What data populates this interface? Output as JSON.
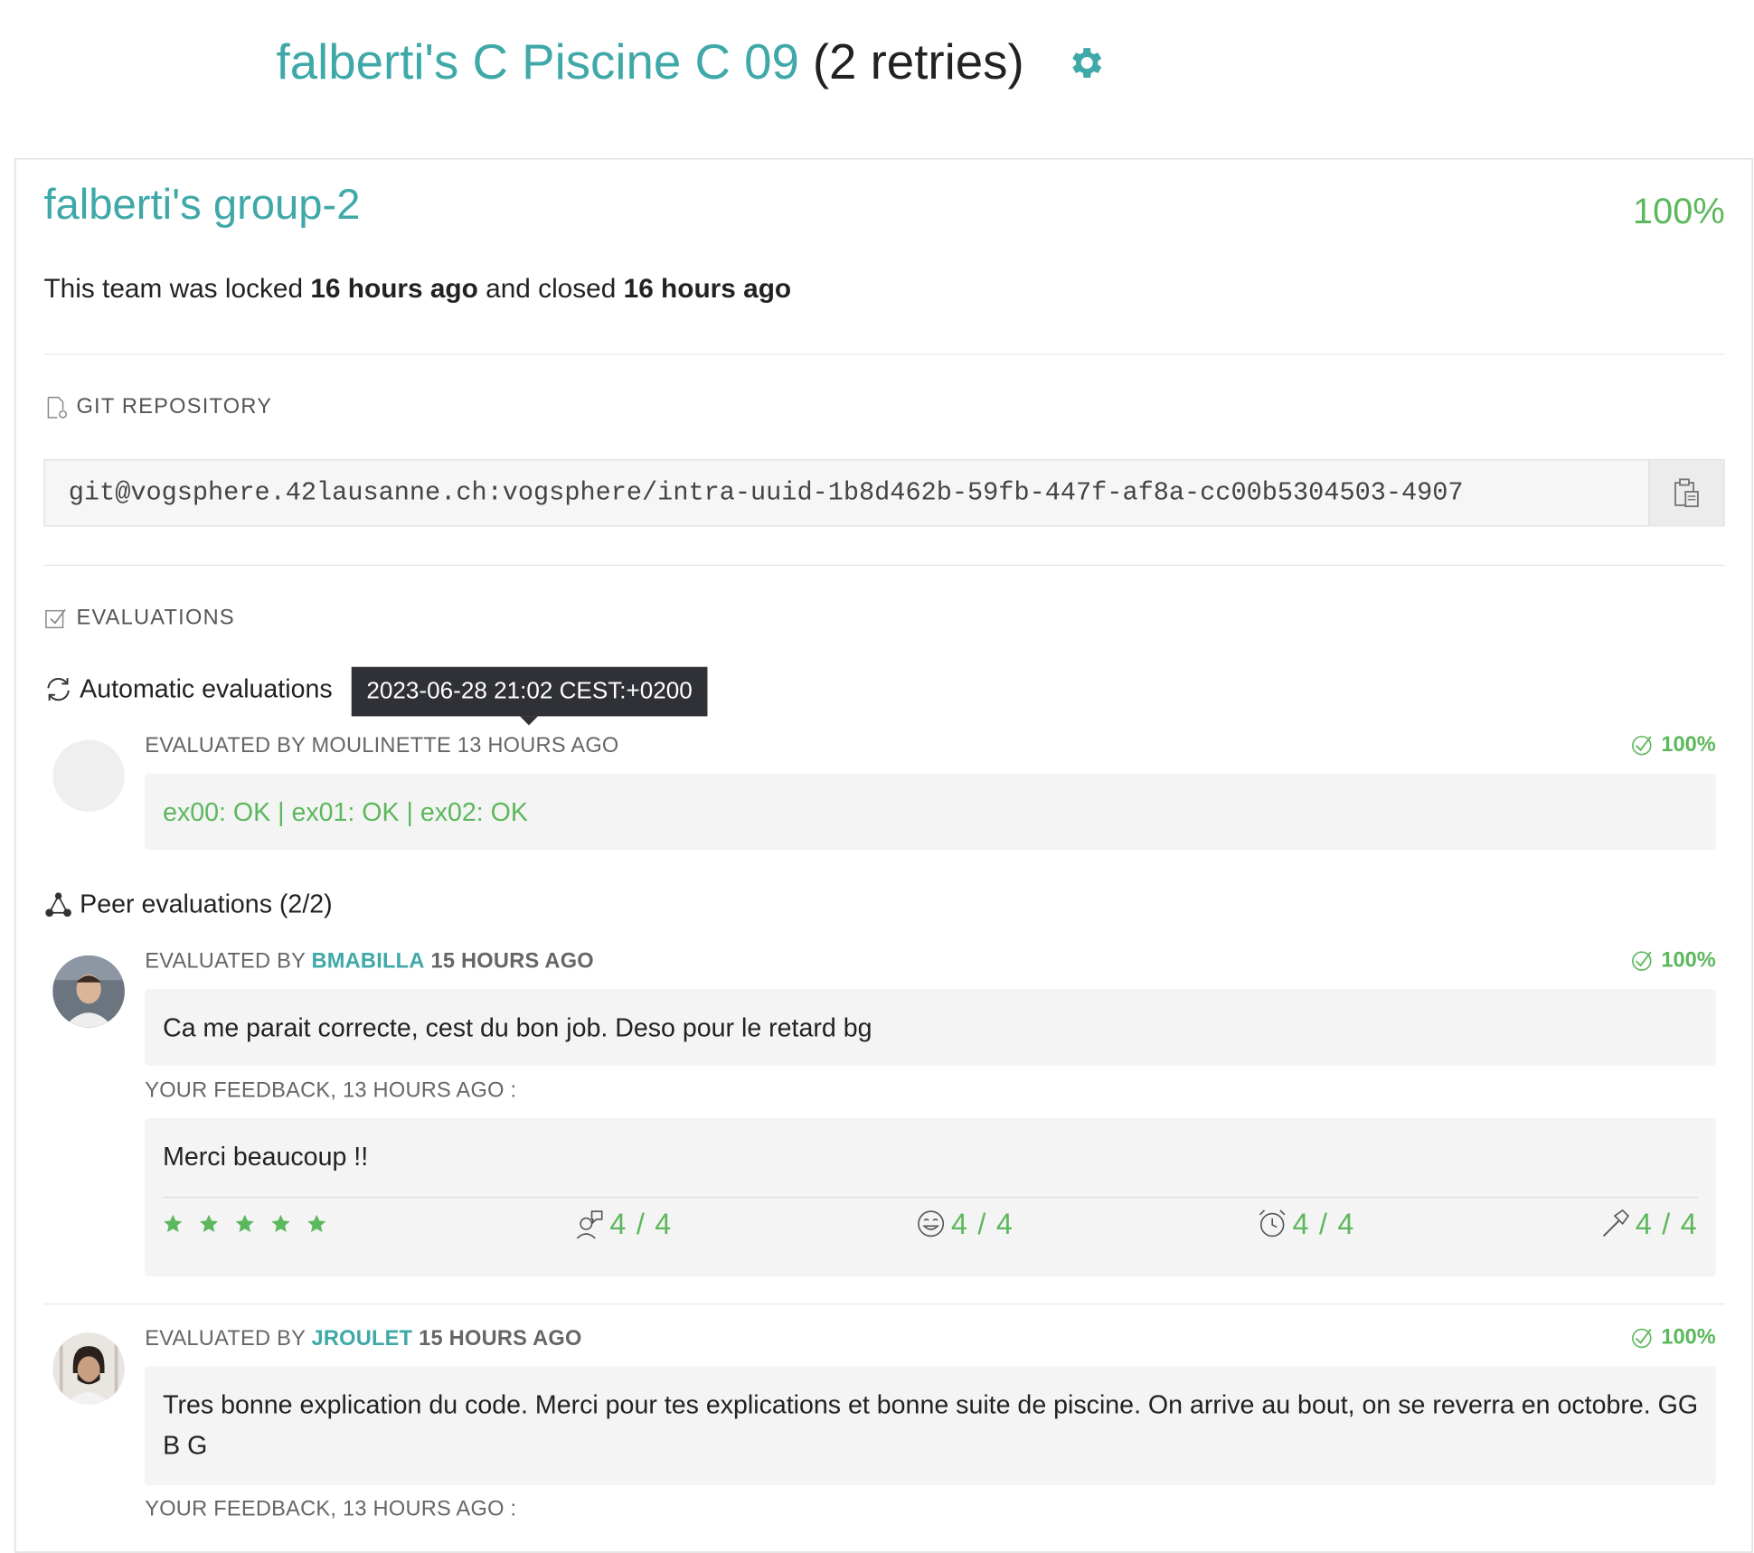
{
  "header": {
    "project_title": "falberti's C Piscine C 09",
    "retries": "(2 retries)",
    "settings_icon": "gear-icon",
    "accent": "#3fa8a8"
  },
  "team": {
    "name": "falberti's group-2",
    "percent": "100%",
    "locked_prefix": "This team was locked",
    "locked_time": "16 hours ago",
    "closed_prefix": "and closed",
    "closed_time": "16 hours ago"
  },
  "git": {
    "section_title": "GIT REPOSITORY",
    "url": "git@vogsphere.42lausanne.ch:vogsphere/intra-uuid-1b8d462b-59fb-447f-af8a-cc00b5304503-4907",
    "copy_icon": "clipboard-icon"
  },
  "evaluations": {
    "section_title": "EVALUATIONS",
    "automatic_title": "Automatic evaluations",
    "tooltip": "2023-06-28 21:02 CEST:+0200",
    "automatic": {
      "prefix": "EVALUATED BY",
      "evaluator": "MOULINETTE",
      "when": "13 HOURS AGO",
      "percent": "100%",
      "result": "ex00: OK | ex01: OK | ex02: OK"
    },
    "peer_title": "Peer evaluations (2/2)",
    "peers": [
      {
        "prefix": "EVALUATED BY",
        "evaluator": "BMABILLA",
        "when": "15 HOURS AGO",
        "percent": "100%",
        "comment": "Ca me parait correcte, cest du bon job. Deso pour le retard bg",
        "feedback_label": "YOUR FEEDBACK,",
        "feedback_when": "13 HOURS AGO :",
        "feedback": "Merci beaucoup !!",
        "stars": 5,
        "scores": [
          "4 / 4",
          "4 / 4",
          "4 / 4",
          "4 / 4"
        ]
      },
      {
        "prefix": "EVALUATED BY",
        "evaluator": "JROULET",
        "when": "15 HOURS AGO",
        "percent": "100%",
        "comment": "Tres bonne explication du code. Merci pour tes explications et bonne suite de piscine. On arrive au bout, on se reverra en octobre. GG B G",
        "feedback_label": "YOUR FEEDBACK,",
        "feedback_when": "13 HOURS AGO :"
      }
    ]
  }
}
